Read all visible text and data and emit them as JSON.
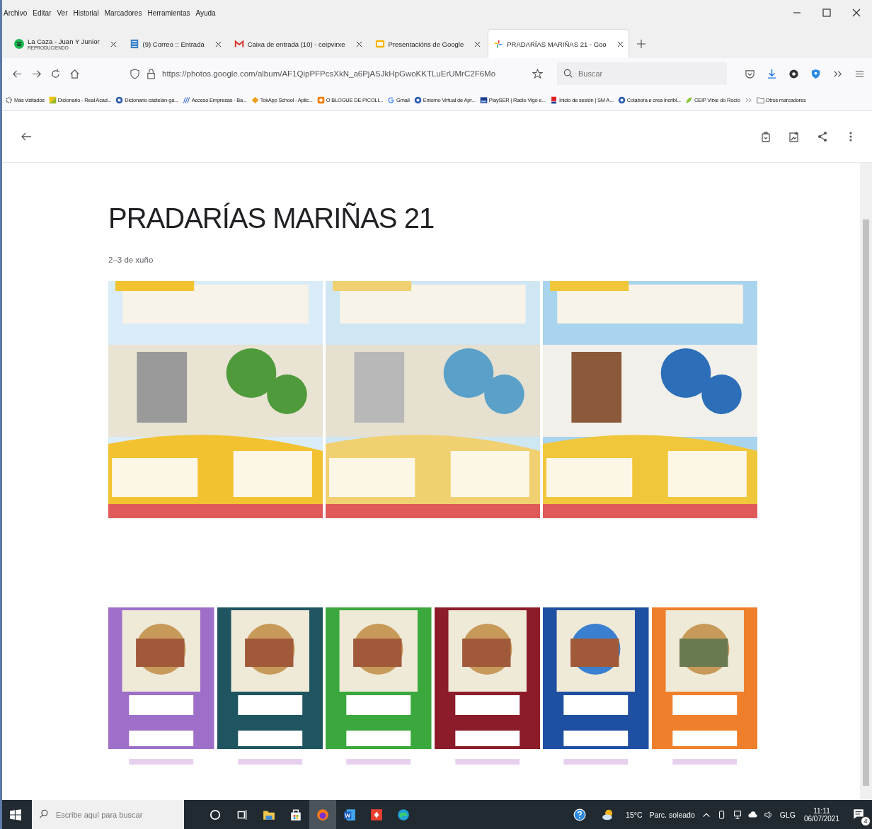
{
  "menu": [
    "Archivo",
    "Editar",
    "Ver",
    "Historial",
    "Marcadores",
    "Herramientas",
    "Ayuda"
  ],
  "tabs": [
    {
      "title": "La Caza - Juan Y Junior",
      "subtitle": "REPRODUCIENDO",
      "selected": false
    },
    {
      "title": "(9) Correo :: Entrada",
      "selected": false
    },
    {
      "title": "Caixa de entrada (10) - ceipvirxe",
      "selected": false
    },
    {
      "title": "Presentacións de Google",
      "selected": false
    },
    {
      "title": "PRADARÍAS MARIÑAS 21 - Goo",
      "selected": true
    }
  ],
  "address": {
    "url": "https://photos.google.com/album/AF1QipPFPcsXkN_a6PjASJkHpGwoKKTLuErUMrC2F6Mo"
  },
  "search": {
    "placeholder": "Buscar"
  },
  "bookmarks": [
    "Más visitados",
    "Dicionario - Real Acad...",
    "Dicionario castelán-ga...",
    "Acceso Empresas - Ba...",
    "TokApp School - Aplic...",
    "O BLOGUE DE PICOLI...",
    "Gmail",
    "Entorno Virtual de Apr...",
    "PlaySER | Radio Vigo e...",
    "Inicio de sesión | SM A...",
    "Colabora e crea incribl...",
    "CEIP Virxe do Rocío"
  ],
  "other_bookmarks": "Otros marcadores",
  "album": {
    "title": "PRADARÍAS MARIÑAS 21",
    "date": "2–3 de xuño"
  },
  "taskbar": {
    "search_placeholder": "Escribe aquí para buscar",
    "temperature": "15°C",
    "weather": "Parc. soleado",
    "language": "GLG",
    "time": "11:11",
    "date": "06/07/2021",
    "notifications": "4"
  }
}
